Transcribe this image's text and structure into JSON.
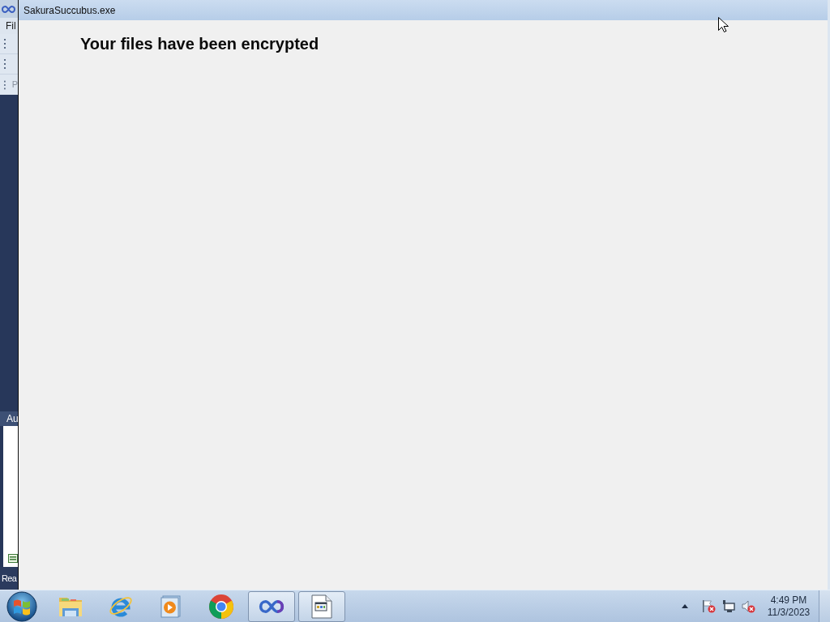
{
  "background_window": {
    "menu": "Fil",
    "toolbar_label": "P",
    "panel_title": "Au",
    "status": "Rea"
  },
  "window": {
    "title": "SakuraSuccubus.exe",
    "heading": "Your files have been encrypted"
  },
  "taskbar": {
    "items": [
      {
        "kind": "folder",
        "running": false
      },
      {
        "kind": "letter-e",
        "running": false
      },
      {
        "kind": "play",
        "running": false
      },
      {
        "kind": "ring",
        "running": false
      },
      {
        "kind": "infinity",
        "running": true
      },
      {
        "kind": "document",
        "running": true
      }
    ]
  },
  "clock": {
    "time": "4:49 PM",
    "date": "11/3/2023"
  }
}
